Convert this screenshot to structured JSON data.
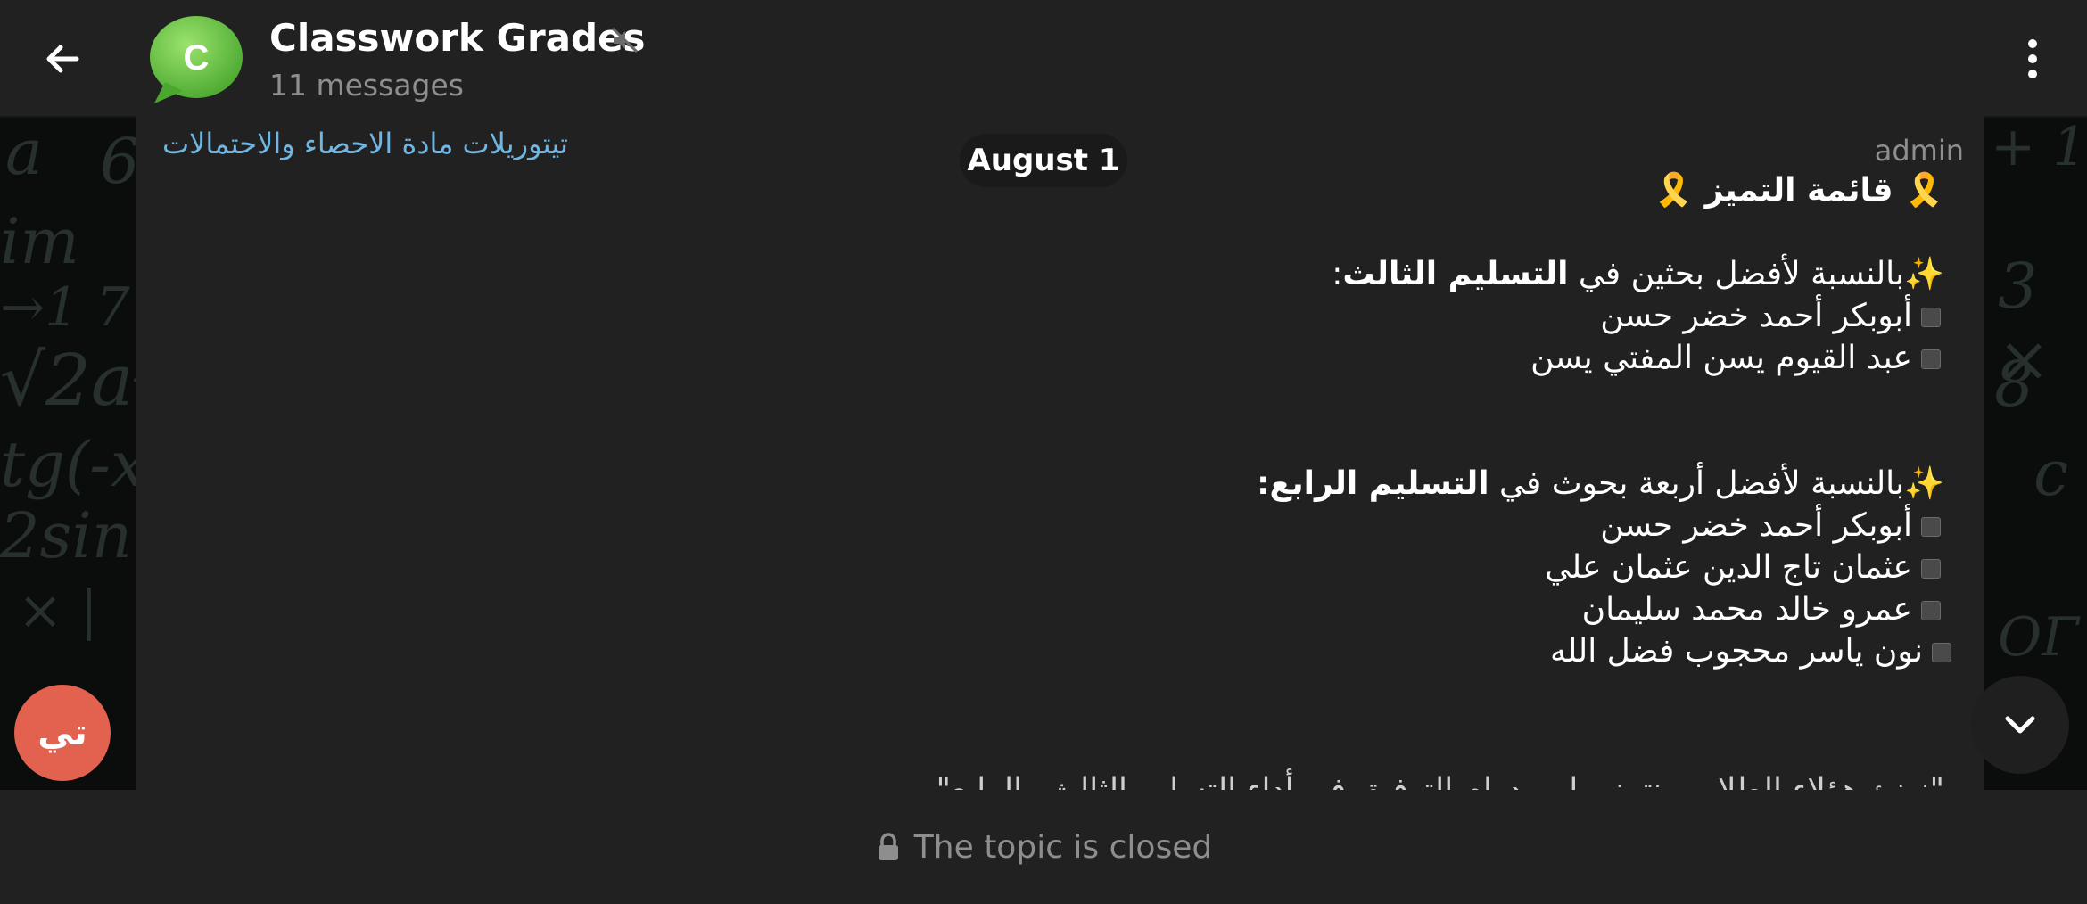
{
  "header": {
    "title": "Classwork Grades",
    "subtitle": "11 messages",
    "avatar_letter": "C",
    "avatar_color": "#6cc24a"
  },
  "message": {
    "topic_link": "تيتوريلات مادة الاحصاء والاحتمالات",
    "date_chip": "August 1",
    "sender": "admin",
    "heading": "قائمة التميز",
    "section1_intro": "بالنسبة لأفضل بحثين في",
    "section1_bold": "التسليم الثالث",
    "section1_names": [
      "أبوبكر أحمد خضر حسن",
      "عبد القيوم يسن المفتي يسن"
    ],
    "section2_intro": "بالنسبة لأفضل أربعة بحوث في",
    "section2_bold": "التسليم الرابع",
    "section2_names": [
      "أبوبكر أحمد خضر حسن",
      "عثمان تاج الدين عثمان علي",
      "عمرو خالد محمد سليمان",
      "نون ياسر محجوب فضل الله"
    ],
    "truncated_line": "\"نهنئ هؤلاء الطلاب ونتمنى لهم دوام التوفيق في أداء التسليم الثالث والرابع\""
  },
  "floating_avatar": {
    "label": "تي",
    "color": "#e2614f"
  },
  "bottom_bar": {
    "text": "The topic is closed"
  },
  "colors": {
    "background": "#212121",
    "link": "#6fb6e2",
    "muted": "#8e8e8e"
  }
}
